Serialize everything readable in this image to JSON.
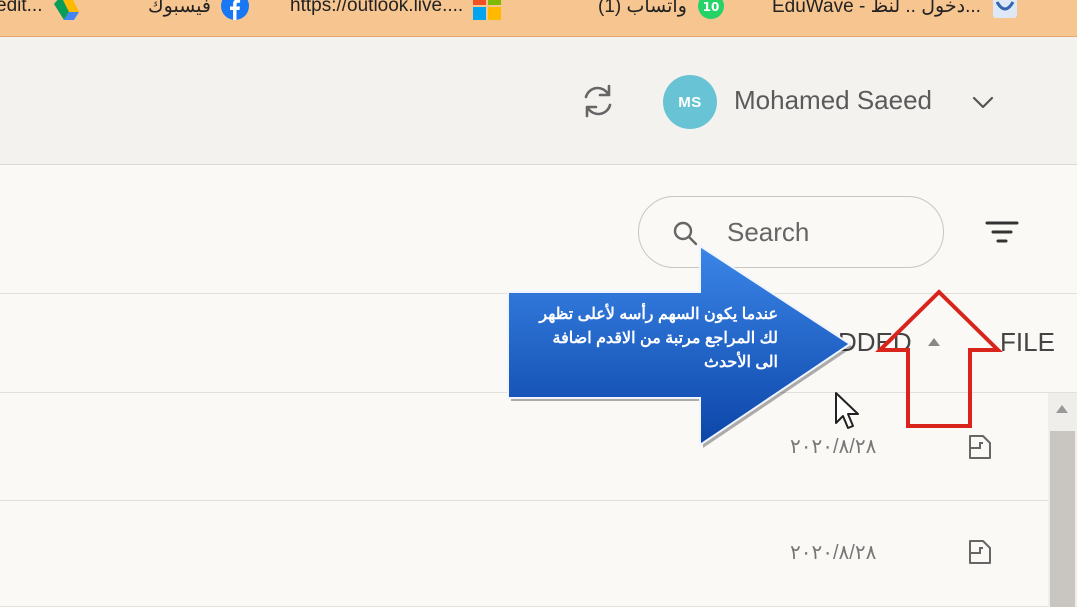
{
  "bookmarks": [
    {
      "label": "edit...",
      "icon": "google-drive-icon"
    },
    {
      "label": "فيسبوك",
      "icon": "facebook-icon"
    },
    {
      "label": "https://outlook.live....",
      "icon": "microsoft-icon"
    },
    {
      "label": "(1) واتساب",
      "icon": "whatsapp-icon"
    },
    {
      "label": "EduWave - دخول .. لنظ...",
      "icon": "eduwave-icon"
    }
  ],
  "header": {
    "avatar_initials": "MS",
    "user_name": "Mohamed Saeed",
    "avatar_color": "#68c4d4"
  },
  "toolbar": {
    "search_placeholder": "Search"
  },
  "columns": {
    "added": "DDED",
    "file": "FILE"
  },
  "rows": [
    {
      "date": "٢٠٢٠/٨/٢٨"
    },
    {
      "date": "٢٠٢٠/٨/٢٨"
    }
  ],
  "annotation": {
    "text": "عندما يكون السهم رأسه لأعلى تظهر لك المراجع مرتبة من الاقدم اضافة الى الأحدث",
    "arrow_color": "#1c5fcb",
    "highlight_color": "#d9241c"
  }
}
